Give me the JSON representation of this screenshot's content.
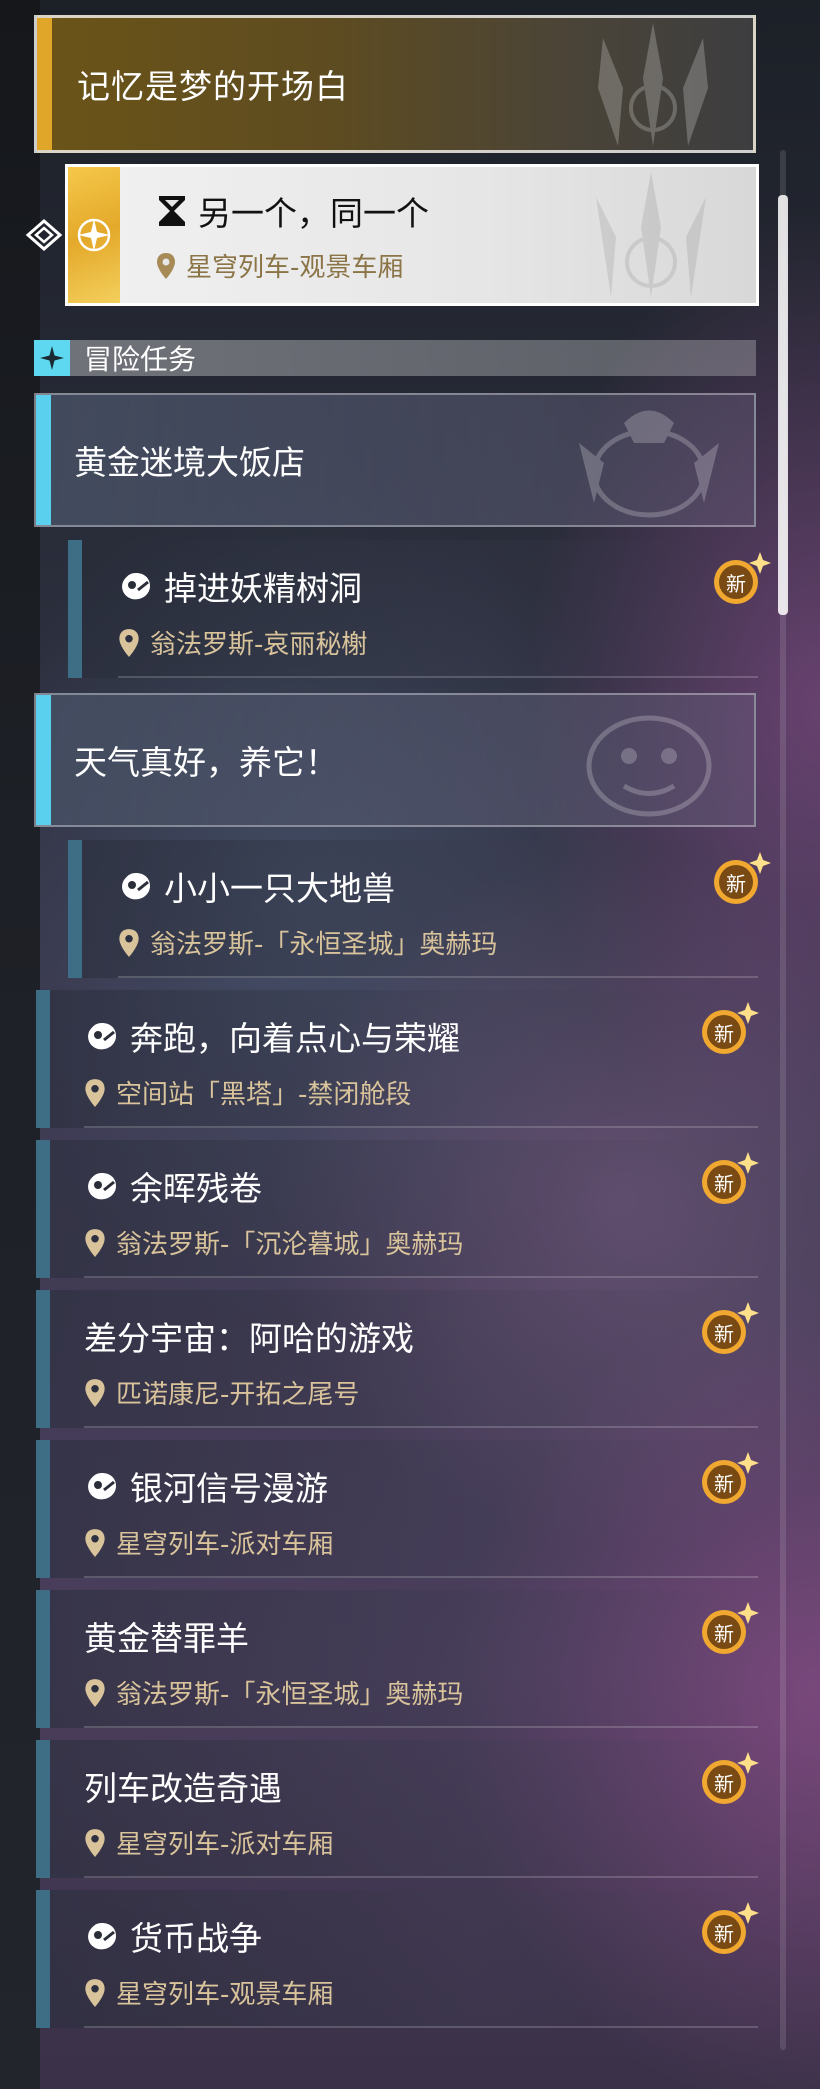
{
  "main_story": {
    "title": "记忆是梦的开场白",
    "sub_quest": {
      "title": "另一个，同一个",
      "location": "星穹列车-观景车厢",
      "icon": "hourglass-icon"
    }
  },
  "section": {
    "label": "冒险任务",
    "icon": "sparkle-icon"
  },
  "badge_label": "新",
  "groups": [
    {
      "title": "黄金迷境大饭店",
      "quests": [
        {
          "title": "掉进妖精树洞",
          "location": "翁法罗斯-哀丽秘榭",
          "icon": "adventure-icon",
          "new": true
        }
      ]
    },
    {
      "title": "天气真好，养它！",
      "quests": [
        {
          "title": "小小一只大地兽",
          "location": "翁法罗斯-「永恒圣城」奥赫玛",
          "icon": "adventure-icon",
          "new": true
        }
      ]
    }
  ],
  "quests": [
    {
      "title": "奔跑，向着点心与荣耀",
      "location": "空间站「黑塔」-禁闭舱段",
      "icon": "adventure-icon",
      "new": true
    },
    {
      "title": "余晖残卷",
      "location": "翁法罗斯-「沉沦暮城」奥赫玛",
      "icon": "adventure-icon",
      "new": true
    },
    {
      "title": "差分宇宙：阿哈的游戏",
      "location": "匹诺康尼-开拓之尾号",
      "icon": "",
      "new": true
    },
    {
      "title": "银河信号漫游",
      "location": "星穹列车-派对车厢",
      "icon": "adventure-icon",
      "new": true
    },
    {
      "title": "黄金替罪羊",
      "location": "翁法罗斯-「永恒圣城」奥赫玛",
      "icon": "",
      "new": true
    },
    {
      "title": "列车改造奇遇",
      "location": "星穹列车-派对车厢",
      "icon": "",
      "new": true
    },
    {
      "title": "货币战争",
      "location": "星穹列车-观景车厢",
      "icon": "adventure-icon",
      "new": true
    }
  ],
  "colors": {
    "main_accent": "#e0a62a",
    "group_accent": "#5bd0ee",
    "quest_bar": "#3e6e86",
    "location_text": "#d9c39b",
    "badge": "#f0a830"
  }
}
